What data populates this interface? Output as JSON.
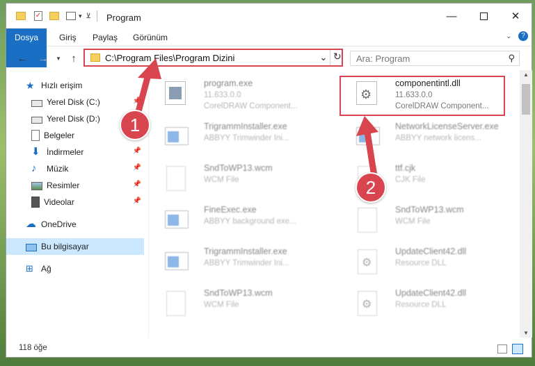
{
  "window": {
    "title": "Program"
  },
  "ribbon": {
    "tabs": [
      "Dosya",
      "Giriş",
      "Paylaş",
      "Görünüm"
    ]
  },
  "address": {
    "path": "C:\\Program Files\\Program Dizini"
  },
  "search": {
    "placeholder": "Ara: Program"
  },
  "sidebar": {
    "items": [
      {
        "label": "Hızlı erişim",
        "icon": "star-icon"
      },
      {
        "label": "Yerel Disk (C:)",
        "icon": "drive-icon",
        "pinned": true
      },
      {
        "label": "Yerel Disk (D:)",
        "icon": "drive-icon",
        "pinned": true
      },
      {
        "label": "Belgeler",
        "icon": "documents-icon",
        "pinned": true
      },
      {
        "label": "İndirmeler",
        "icon": "download-icon",
        "pinned": true
      },
      {
        "label": "Müzik",
        "icon": "music-icon",
        "pinned": true
      },
      {
        "label": "Resimler",
        "icon": "pictures-icon",
        "pinned": true
      },
      {
        "label": "Videolar",
        "icon": "videos-icon",
        "pinned": true
      },
      {
        "label": "OneDrive",
        "icon": "cloud-icon"
      },
      {
        "label": "Bu bilgisayar",
        "icon": "computer-icon",
        "selected": true
      },
      {
        "label": "Ağ",
        "icon": "network-icon"
      }
    ]
  },
  "files": [
    {
      "name": "program.exe",
      "sub": "11.633.0.0",
      "sub2": "CorelDRAW Component...",
      "icon": "exe-icon"
    },
    {
      "name": "componentintl.dll",
      "sub": "11.633.0.0",
      "sub2": "CorelDRAW Component...",
      "icon": "dll-icon",
      "highlighted": true
    },
    {
      "name": "TrigrammInstaller.exe",
      "sub": "ABBYY Trimwinder Ini...",
      "icon": "exe-window-icon"
    },
    {
      "name": "NetworkLicenseServer.exe",
      "sub": "ABBYY network licens...",
      "icon": "exe-window-icon"
    },
    {
      "name": "SndToWP13.wcm",
      "sub": "WCM File",
      "icon": "blank-file-icon"
    },
    {
      "name": "ttf.cjk",
      "sub": "CJK File",
      "icon": "blank-file-icon"
    },
    {
      "name": "FineExec.exe",
      "sub": "ABBYY background exe...",
      "icon": "exe-window-icon"
    },
    {
      "name": "SndToWP13.wcm",
      "sub": "WCM File",
      "icon": "blank-file-icon"
    },
    {
      "name": "TrigrammInstaller.exe",
      "sub": "ABBYY Trimwinder Ini...",
      "icon": "exe-window-icon"
    },
    {
      "name": "UpdateClient42.dll",
      "sub": "Resource DLL",
      "icon": "dll-icon"
    },
    {
      "name": "SndToWP13.wcm",
      "sub": "WCM File",
      "icon": "blank-file-icon"
    },
    {
      "name": "UpdateClient42.dll",
      "sub": "Resource DLL",
      "icon": "dll-icon"
    }
  ],
  "status": {
    "count": "118 öğe"
  },
  "callouts": [
    "1",
    "2"
  ],
  "colors": {
    "accent": "#1a6fc4",
    "highlight": "#d9454e",
    "selected": "#cce8ff"
  }
}
